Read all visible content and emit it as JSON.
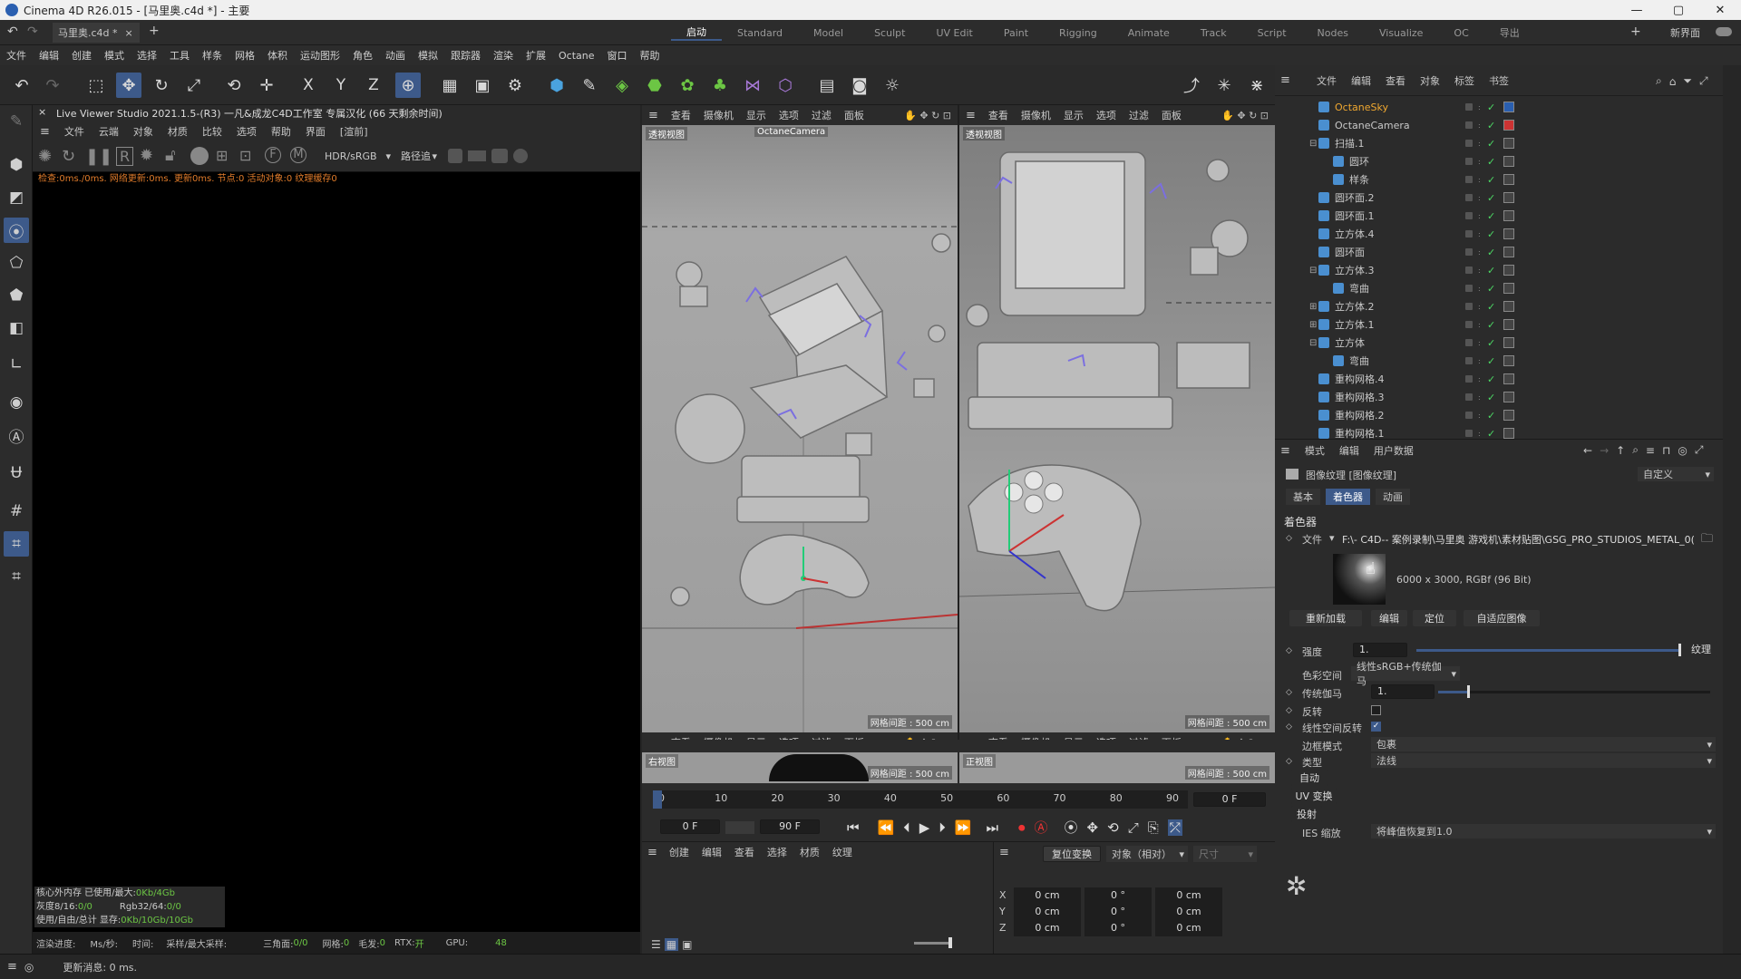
{
  "window": {
    "title": "Cinema 4D R26.015 - [马里奥.c4d *] - 主要",
    "min": "—",
    "max": "▢",
    "close": "✕"
  },
  "tabs": {
    "doc_tab": "马里奥.c4d *",
    "layouts": [
      "启动",
      "Standard",
      "Model",
      "Sculpt",
      "UV Edit",
      "Paint",
      "Rigging",
      "Animate",
      "Track",
      "Script",
      "Nodes",
      "Visualize",
      "OC",
      "导出"
    ],
    "new_layout": "新界面"
  },
  "menu": [
    "文件",
    "编辑",
    "创建",
    "模式",
    "选择",
    "工具",
    "样条",
    "网格",
    "体积",
    "运动图形",
    "角色",
    "动画",
    "模拟",
    "跟踪器",
    "渲染",
    "扩展",
    "Octane",
    "窗口",
    "帮助"
  ],
  "toolbar": {
    "axis_x": "X",
    "axis_y": "Y",
    "axis_z": "Z"
  },
  "live_viewer": {
    "header": "Live Viewer Studio 2021.1.5-(R3) 一凡&成龙C4D工作室 专属汉化 (66 天剩余时间)",
    "menu": [
      "文件",
      "云端",
      "对象",
      "材质",
      "比较",
      "选项",
      "帮助",
      "界面",
      "[渲前]"
    ],
    "color_mode": "HDR/sRGB",
    "kernel": "路径追",
    "status": "检查:0ms./0ms. 网络更新:0ms. 更新0ms. 节点:0 活动对象:0 纹理缓存0",
    "stats": [
      {
        "label": "核心外内存 已使用/最大:",
        "value": "0Kb/4Gb"
      },
      {
        "label": "灰度8/16:",
        "value": "0/0",
        "label2": "Rgb32/64:",
        "value2": "0/0"
      },
      {
        "label": "使用/自由/总计 显存:",
        "value": "0Kb/10Gb/10Gb"
      }
    ],
    "footer": {
      "progress_label": "渲染进度:",
      "ms_label": "Ms/秒:",
      "time_label": "时间:",
      "samples_label": "采样/最大采样:",
      "tri_label": "三角面:",
      "tri": "0/0",
      "mesh_label": "网格:",
      "mesh": "0",
      "hair_label": "毛发:",
      "hair": "0",
      "rtx_label": "RTX:",
      "rtx": "开",
      "gpu_label": "GPU:",
      "gpu": "48"
    }
  },
  "viewports": {
    "menu": [
      "查看",
      "摄像机",
      "显示",
      "选项",
      "过滤",
      "面板"
    ],
    "tl_label": "透视视图",
    "tl_camera": "OctaneCamera",
    "tl_grid": "网格间距 : 500 cm",
    "tr_label": "透视视图",
    "tr_grid": "网格间距 : 500 cm",
    "bl_label": "右视图",
    "bl_grid": "网格间距 : 500 cm",
    "br_label": "正视图",
    "br_grid": "网格间距 : 500 cm"
  },
  "timeline": {
    "ticks": [
      "0",
      "10",
      "20",
      "30",
      "40",
      "50",
      "60",
      "70",
      "80",
      "90"
    ],
    "current_frame": "0 F",
    "start": "0 F",
    "end": "90 F"
  },
  "material_manager": {
    "menu": [
      "创建",
      "编辑",
      "查看",
      "选择",
      "材质",
      "纹理"
    ]
  },
  "coords": {
    "reset_btn": "复位变换",
    "mode": "对象（相对）",
    "size_label": "尺寸",
    "rows": [
      {
        "axis": "X",
        "pos": "0 cm",
        "rot": "0 °",
        "size": "0 cm"
      },
      {
        "axis": "Y",
        "pos": "0 cm",
        "rot": "0 °",
        "size": "0 cm"
      },
      {
        "axis": "Z",
        "pos": "0 cm",
        "rot": "0 °",
        "size": "0 cm"
      }
    ]
  },
  "object_manager": {
    "menu": [
      "文件",
      "编辑",
      "查看",
      "对象",
      "标签",
      "书签"
    ],
    "objects": [
      {
        "name": "OctaneSky",
        "indent": 0,
        "color": "#f0a830",
        "icon": "sky-icon",
        "tag": "#2a5fb0"
      },
      {
        "name": "OctaneCamera",
        "indent": 0,
        "color": "#c8c8c8",
        "icon": "camera-icon",
        "tag": "#c33"
      },
      {
        "name": "扫描.1",
        "indent": 0,
        "color": "#c8c8c8",
        "icon": "sweep-icon",
        "expand": "⊟"
      },
      {
        "name": "圆环",
        "indent": 1,
        "color": "#c8c8c8",
        "icon": "circle-spline-icon"
      },
      {
        "name": "样条",
        "indent": 1,
        "color": "#c8c8c8",
        "icon": "spline-icon"
      },
      {
        "name": "圆环面.2",
        "indent": 0,
        "color": "#c8c8c8",
        "icon": "torus-icon"
      },
      {
        "name": "圆环面.1",
        "indent": 0,
        "color": "#c8c8c8",
        "icon": "torus-icon"
      },
      {
        "name": "立方体.4",
        "indent": 0,
        "color": "#c8c8c8",
        "icon": "cube-icon"
      },
      {
        "name": "圆环面",
        "indent": 0,
        "color": "#c8c8c8",
        "icon": "torus-icon"
      },
      {
        "name": "立方体.3",
        "indent": 0,
        "color": "#c8c8c8",
        "icon": "cube-icon",
        "expand": "⊟"
      },
      {
        "name": "弯曲",
        "indent": 1,
        "color": "#c8c8c8",
        "icon": "bend-icon"
      },
      {
        "name": "立方体.2",
        "indent": 0,
        "color": "#c8c8c8",
        "icon": "cube-icon",
        "expand": "⊞"
      },
      {
        "name": "立方体.1",
        "indent": 0,
        "color": "#c8c8c8",
        "icon": "cube-icon",
        "expand": "⊞"
      },
      {
        "name": "立方体",
        "indent": 0,
        "color": "#c8c8c8",
        "icon": "cube-icon",
        "expand": "⊟"
      },
      {
        "name": "弯曲",
        "indent": 1,
        "color": "#c8c8c8",
        "icon": "bend-icon"
      },
      {
        "name": "重构网格.4",
        "indent": 0,
        "color": "#c8c8c8",
        "icon": "remesh-icon"
      },
      {
        "name": "重构网格.3",
        "indent": 0,
        "color": "#c8c8c8",
        "icon": "remesh-icon"
      },
      {
        "name": "重构网格.2",
        "indent": 0,
        "color": "#c8c8c8",
        "icon": "remesh-icon"
      },
      {
        "name": "重构网格.1",
        "indent": 0,
        "color": "#c8c8c8",
        "icon": "remesh-icon"
      }
    ]
  },
  "attributes": {
    "menu": [
      "模式",
      "编辑",
      "用户数据"
    ],
    "title": "图像纹理 [图像纹理]",
    "preset": "自定义",
    "tabs": [
      "基本",
      "着色器",
      "动画"
    ],
    "section": "着色器",
    "file_label": "文件",
    "file_path": "F:\\- C4D-- 案例录制\\马里奥 游戏机\\素材贴图\\GSG_PRO_STUDIOS_METAL_0(",
    "image_info": "6000 x 3000, RGBf (96 Bit)",
    "buttons": [
      "重新加载",
      "编辑",
      "定位",
      "自适应图像"
    ],
    "power_label": "强度",
    "power": "1.",
    "texture_btn": "纹理",
    "colorspace_label": "色彩空间",
    "colorspace": "线性sRGB+传统伽马",
    "gamma_label": "传统伽马",
    "gamma": "1.",
    "invert_label": "反转",
    "linear_invert_label": "线性空间反转",
    "border_label": "边框模式",
    "border": "包裹",
    "type_label": "类型",
    "type": "法线",
    "auto_label": "自动",
    "uv_label": "UV 变换",
    "proj_label": "投射",
    "ies_label": "IES 缩放",
    "ies": "将峰值恢复到1.0"
  },
  "status_bar": {
    "text": "更新消息: 0 ms."
  },
  "colors": {
    "accent": "#3d5a8a",
    "check": "#4cd964",
    "status_orange": "#e07b2a",
    "gpu_green": "#6cc644"
  }
}
